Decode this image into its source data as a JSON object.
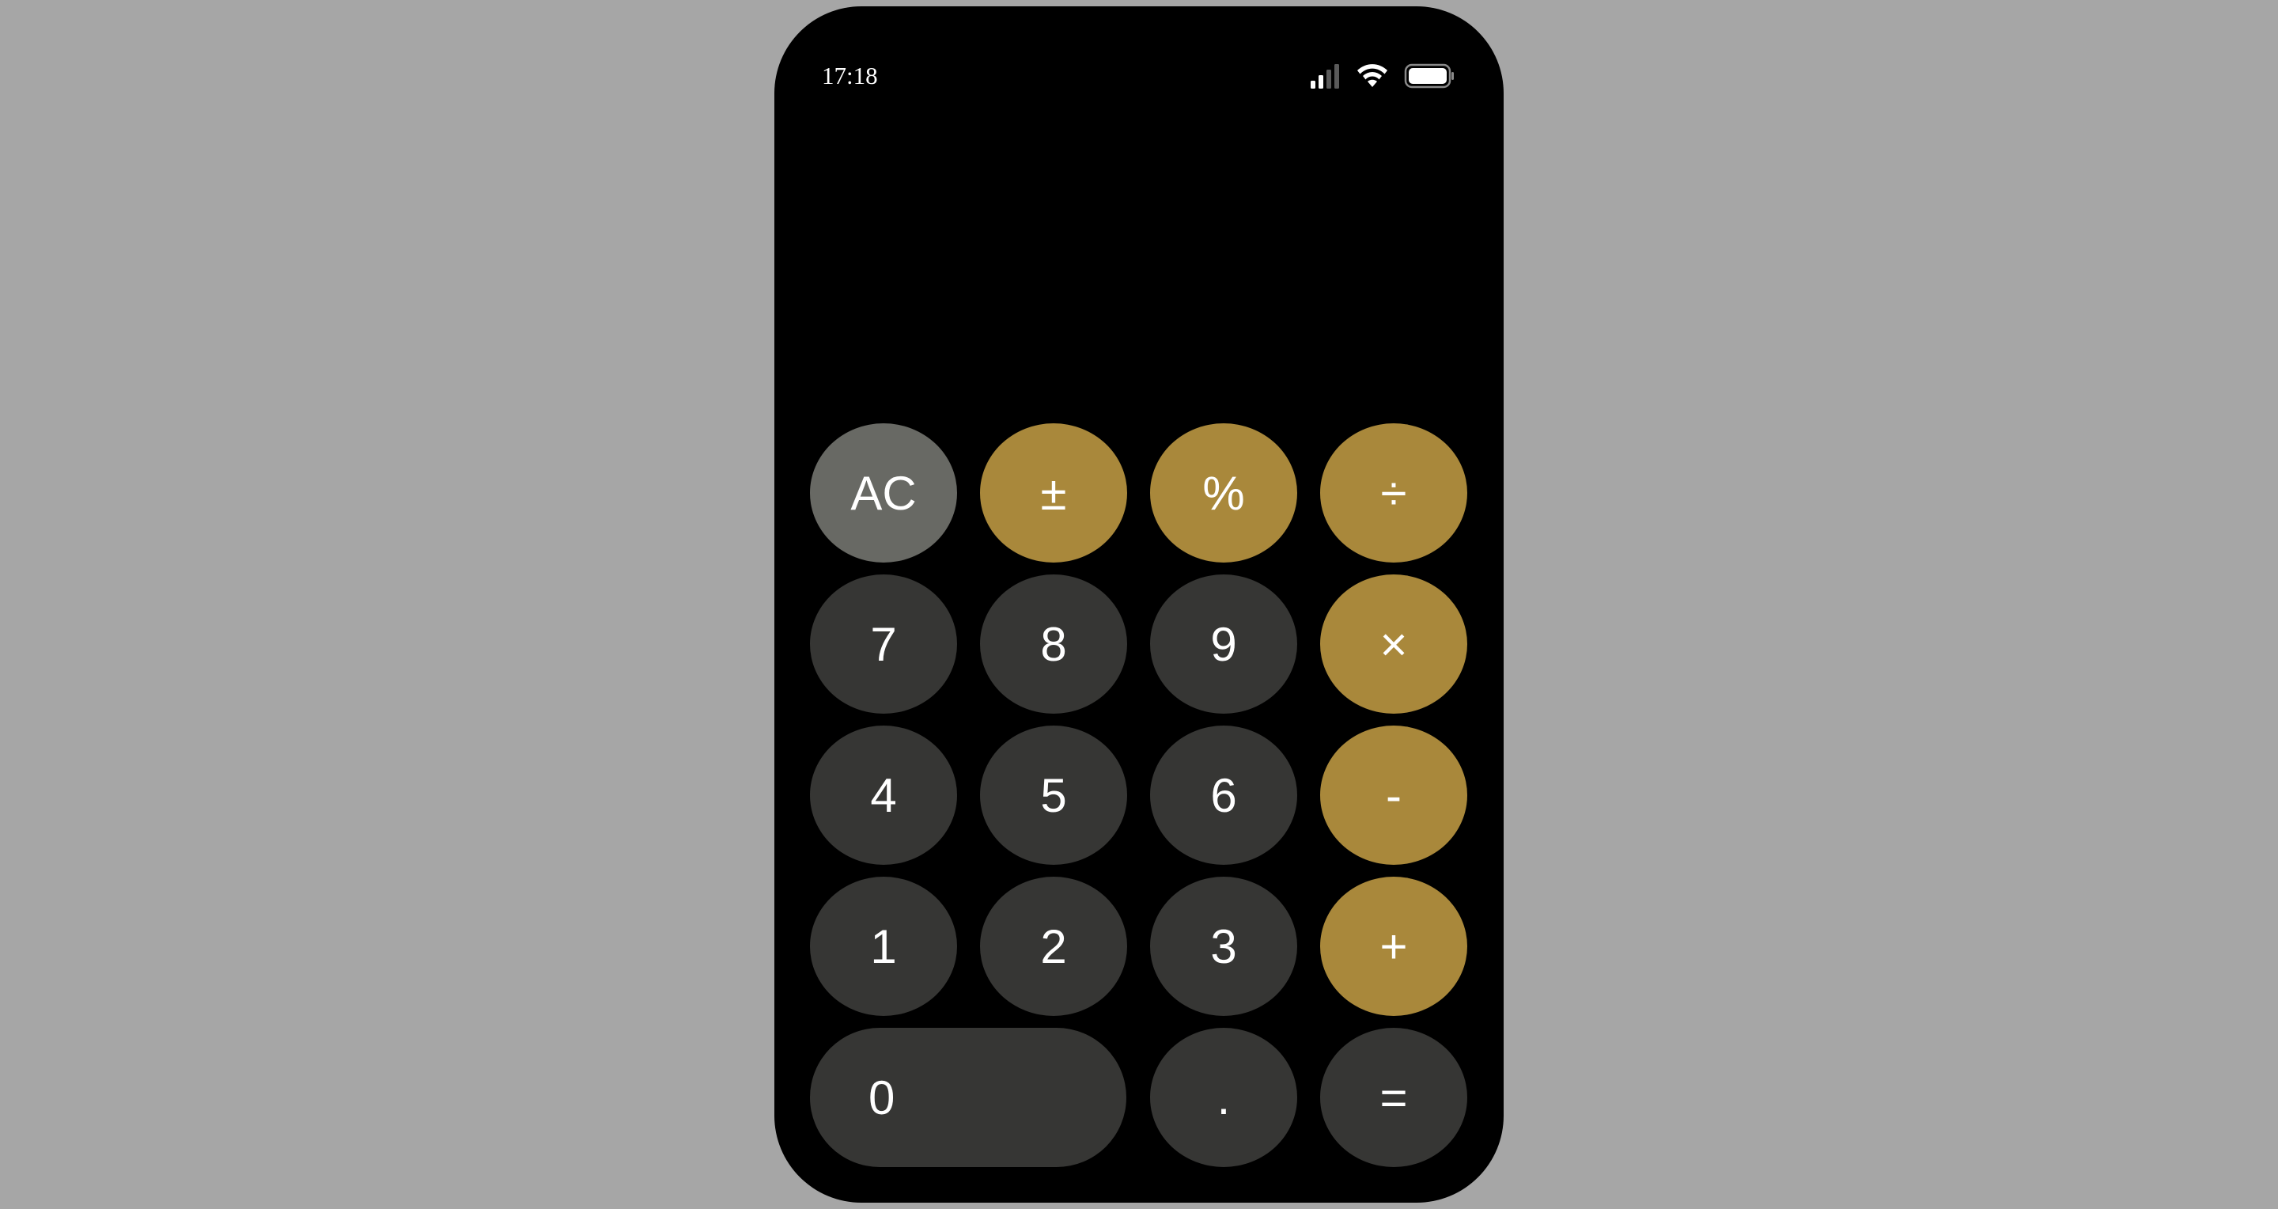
{
  "status_bar": {
    "time": "17:18",
    "icons": [
      "cellular-signal-icon",
      "wifi-icon",
      "battery-icon"
    ]
  },
  "display": {
    "value": ""
  },
  "keys": {
    "ac": "AC",
    "plus_minus": "±",
    "percent": "%",
    "divide": "÷",
    "seven": "7",
    "eight": "8",
    "nine": "9",
    "multiply": "×",
    "four": "4",
    "five": "5",
    "six": "6",
    "minus": "-",
    "one": "1",
    "two": "2",
    "three": "3",
    "plus": "+",
    "zero": "0",
    "decimal": ".",
    "equals": "="
  },
  "colors": {
    "background": "#a6a6a6",
    "phone": "#000000",
    "function_key": "#686964",
    "operator_key": "#a9883b",
    "number_key": "#363634",
    "text": "#ffffff"
  }
}
